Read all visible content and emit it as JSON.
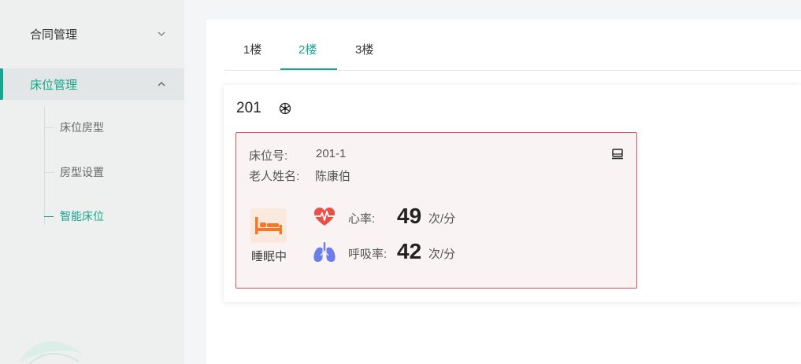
{
  "sidebar": {
    "contract_label": "合同管理",
    "bed_label": "床位管理",
    "sub_items": [
      "床位房型",
      "房型设置",
      "智能床位"
    ]
  },
  "tabs": [
    "1楼",
    "2楼",
    "3楼"
  ],
  "active_tab": "2楼",
  "room": {
    "number": "201",
    "bed": {
      "bed_no_label": "床位号:",
      "bed_no": "201-1",
      "elder_label": "老人姓名:",
      "elder_name": "陈康伯",
      "status": "睡眠中",
      "heart_rate_label": "心率:",
      "heart_rate": "49",
      "heart_rate_unit": "次/分",
      "resp_rate_label": "呼吸率:",
      "resp_rate": "42",
      "resp_rate_unit": "次/分"
    }
  },
  "colors": {
    "accent": "#16a68e",
    "alert_border": "#d9545f",
    "heart": "#e8514a",
    "lung": "#6b7ee8",
    "sleep": "#f07a2a"
  },
  "icons": [
    "chevron-down-icon",
    "chevron-up-icon",
    "snowflake-icon",
    "monitor-icon",
    "bed-icon",
    "heart-pulse-icon",
    "lungs-icon"
  ]
}
